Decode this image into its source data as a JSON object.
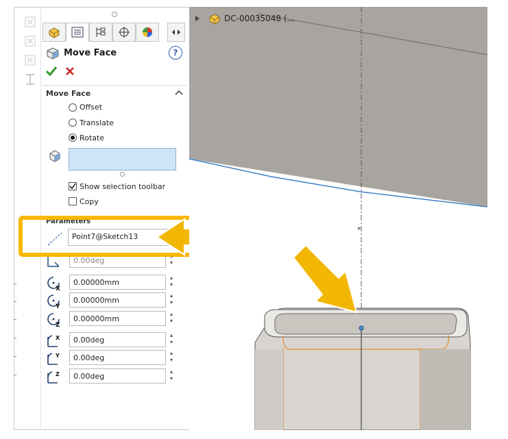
{
  "feature_tree": {
    "part_name": "DC-00035048 (..."
  },
  "panel": {
    "title": "Move Face",
    "help_label": "?",
    "ok_icon": "checkmark-icon",
    "cancel_icon": "x-icon",
    "move_face_section": {
      "heading": "Move Face",
      "options": [
        {
          "label": "Offset",
          "selected": false
        },
        {
          "label": "Translate",
          "selected": false
        },
        {
          "label": "Rotate",
          "selected": true
        }
      ],
      "show_selection_toolbar": {
        "label": "Show selection toolbar",
        "checked": true
      },
      "copy": {
        "label": "Copy",
        "checked": false
      }
    },
    "parameters": {
      "heading": "Parameters",
      "axis_reference": "Point7@Sketch13",
      "hidden_value": "0.00deg",
      "rows": [
        {
          "icon": "rotation-center-x-icon",
          "value": "0.00000mm"
        },
        {
          "icon": "rotation-center-y-icon",
          "value": "0.00000mm"
        },
        {
          "icon": "rotation-center-z-icon",
          "value": "0.00000mm"
        },
        {
          "icon": "rotate-about-x-icon",
          "value": "0.00deg"
        },
        {
          "icon": "rotate-about-y-icon",
          "value": "0.00deg"
        },
        {
          "icon": "rotate-about-z-icon",
          "value": "0.00deg"
        }
      ]
    }
  },
  "colors": {
    "highlight": "#f6b800",
    "arrow": "#f2b705",
    "selection_box": "#cfe4f7",
    "model_edge": "#e08a2c",
    "ok": "#2e9a2e",
    "cancel": "#cc2222"
  }
}
